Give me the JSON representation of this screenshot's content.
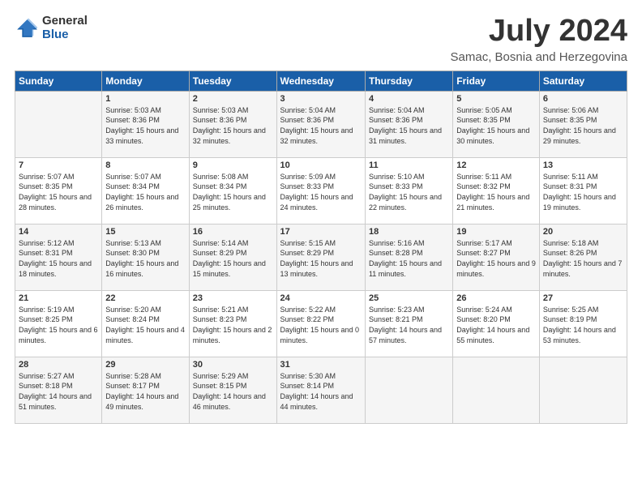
{
  "logo": {
    "general": "General",
    "blue": "Blue"
  },
  "title": "July 2024",
  "location": "Samac, Bosnia and Herzegovina",
  "days_of_week": [
    "Sunday",
    "Monday",
    "Tuesday",
    "Wednesday",
    "Thursday",
    "Friday",
    "Saturday"
  ],
  "weeks": [
    [
      {
        "day": "",
        "info": ""
      },
      {
        "day": "1",
        "info": "Sunrise: 5:03 AM\nSunset: 8:36 PM\nDaylight: 15 hours and 33 minutes."
      },
      {
        "day": "2",
        "info": "Sunrise: 5:03 AM\nSunset: 8:36 PM\nDaylight: 15 hours and 32 minutes."
      },
      {
        "day": "3",
        "info": "Sunrise: 5:04 AM\nSunset: 8:36 PM\nDaylight: 15 hours and 32 minutes."
      },
      {
        "day": "4",
        "info": "Sunrise: 5:04 AM\nSunset: 8:36 PM\nDaylight: 15 hours and 31 minutes."
      },
      {
        "day": "5",
        "info": "Sunrise: 5:05 AM\nSunset: 8:35 PM\nDaylight: 15 hours and 30 minutes."
      },
      {
        "day": "6",
        "info": "Sunrise: 5:06 AM\nSunset: 8:35 PM\nDaylight: 15 hours and 29 minutes."
      }
    ],
    [
      {
        "day": "7",
        "info": "Sunrise: 5:07 AM\nSunset: 8:35 PM\nDaylight: 15 hours and 28 minutes."
      },
      {
        "day": "8",
        "info": "Sunrise: 5:07 AM\nSunset: 8:34 PM\nDaylight: 15 hours and 26 minutes."
      },
      {
        "day": "9",
        "info": "Sunrise: 5:08 AM\nSunset: 8:34 PM\nDaylight: 15 hours and 25 minutes."
      },
      {
        "day": "10",
        "info": "Sunrise: 5:09 AM\nSunset: 8:33 PM\nDaylight: 15 hours and 24 minutes."
      },
      {
        "day": "11",
        "info": "Sunrise: 5:10 AM\nSunset: 8:33 PM\nDaylight: 15 hours and 22 minutes."
      },
      {
        "day": "12",
        "info": "Sunrise: 5:11 AM\nSunset: 8:32 PM\nDaylight: 15 hours and 21 minutes."
      },
      {
        "day": "13",
        "info": "Sunrise: 5:11 AM\nSunset: 8:31 PM\nDaylight: 15 hours and 19 minutes."
      }
    ],
    [
      {
        "day": "14",
        "info": "Sunrise: 5:12 AM\nSunset: 8:31 PM\nDaylight: 15 hours and 18 minutes."
      },
      {
        "day": "15",
        "info": "Sunrise: 5:13 AM\nSunset: 8:30 PM\nDaylight: 15 hours and 16 minutes."
      },
      {
        "day": "16",
        "info": "Sunrise: 5:14 AM\nSunset: 8:29 PM\nDaylight: 15 hours and 15 minutes."
      },
      {
        "day": "17",
        "info": "Sunrise: 5:15 AM\nSunset: 8:29 PM\nDaylight: 15 hours and 13 minutes."
      },
      {
        "day": "18",
        "info": "Sunrise: 5:16 AM\nSunset: 8:28 PM\nDaylight: 15 hours and 11 minutes."
      },
      {
        "day": "19",
        "info": "Sunrise: 5:17 AM\nSunset: 8:27 PM\nDaylight: 15 hours and 9 minutes."
      },
      {
        "day": "20",
        "info": "Sunrise: 5:18 AM\nSunset: 8:26 PM\nDaylight: 15 hours and 7 minutes."
      }
    ],
    [
      {
        "day": "21",
        "info": "Sunrise: 5:19 AM\nSunset: 8:25 PM\nDaylight: 15 hours and 6 minutes."
      },
      {
        "day": "22",
        "info": "Sunrise: 5:20 AM\nSunset: 8:24 PM\nDaylight: 15 hours and 4 minutes."
      },
      {
        "day": "23",
        "info": "Sunrise: 5:21 AM\nSunset: 8:23 PM\nDaylight: 15 hours and 2 minutes."
      },
      {
        "day": "24",
        "info": "Sunrise: 5:22 AM\nSunset: 8:22 PM\nDaylight: 15 hours and 0 minutes."
      },
      {
        "day": "25",
        "info": "Sunrise: 5:23 AM\nSunset: 8:21 PM\nDaylight: 14 hours and 57 minutes."
      },
      {
        "day": "26",
        "info": "Sunrise: 5:24 AM\nSunset: 8:20 PM\nDaylight: 14 hours and 55 minutes."
      },
      {
        "day": "27",
        "info": "Sunrise: 5:25 AM\nSunset: 8:19 PM\nDaylight: 14 hours and 53 minutes."
      }
    ],
    [
      {
        "day": "28",
        "info": "Sunrise: 5:27 AM\nSunset: 8:18 PM\nDaylight: 14 hours and 51 minutes."
      },
      {
        "day": "29",
        "info": "Sunrise: 5:28 AM\nSunset: 8:17 PM\nDaylight: 14 hours and 49 minutes."
      },
      {
        "day": "30",
        "info": "Sunrise: 5:29 AM\nSunset: 8:15 PM\nDaylight: 14 hours and 46 minutes."
      },
      {
        "day": "31",
        "info": "Sunrise: 5:30 AM\nSunset: 8:14 PM\nDaylight: 14 hours and 44 minutes."
      },
      {
        "day": "",
        "info": ""
      },
      {
        "day": "",
        "info": ""
      },
      {
        "day": "",
        "info": ""
      }
    ]
  ]
}
